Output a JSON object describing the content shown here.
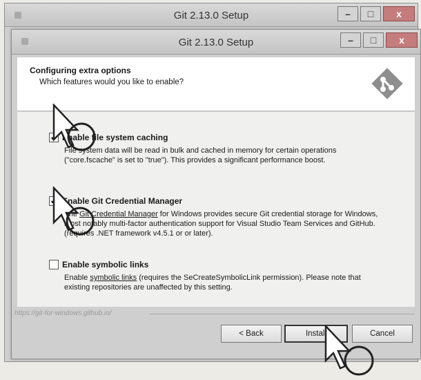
{
  "back_window": {
    "title": "Git 2.13.0 Setup",
    "controls": {
      "minimize": "–",
      "maximize": "□",
      "close": "x"
    }
  },
  "window": {
    "title": "Git 2.13.0 Setup",
    "controls": {
      "minimize": "–",
      "maximize": "□",
      "close": "x"
    }
  },
  "header": {
    "title": "Configuring extra options",
    "subtitle": "Which features would you like to enable?",
    "logo_icon": "git-logo-icon"
  },
  "options": [
    {
      "label": "Enable file system caching",
      "checked": true,
      "description": "File system data will be read in bulk and cached in memory for certain operations (\"core.fscache\" is set to \"true\"). This provides a significant performance boost."
    },
    {
      "label": "Enable Git Credential Manager",
      "checked": true,
      "description_link": "Git Credential Manager",
      "description_prefix": "The ",
      "description_suffix": " for Windows provides secure Git credential storage for Windows, most notably multi-factor authentication support for Visual Studio Team Services and GitHub. (requires .NET framework v4.5.1 or or later)."
    },
    {
      "label": "Enable symbolic links",
      "checked": false,
      "description_prefix": "Enable ",
      "description_link": "symbolic links",
      "description_suffix": " (requires the SeCreateSymbolicLink permission). Please note that existing repositories are unaffected by this setting."
    }
  ],
  "footer": {
    "url": "https://git-for-windows.github.io/"
  },
  "buttons": {
    "back": "< Back",
    "install": "Install",
    "cancel": "Cancel"
  },
  "colors": {
    "close_button": "#c47c7c",
    "header_bg": "#ffffff",
    "content_bg": "#f0f0ef"
  }
}
